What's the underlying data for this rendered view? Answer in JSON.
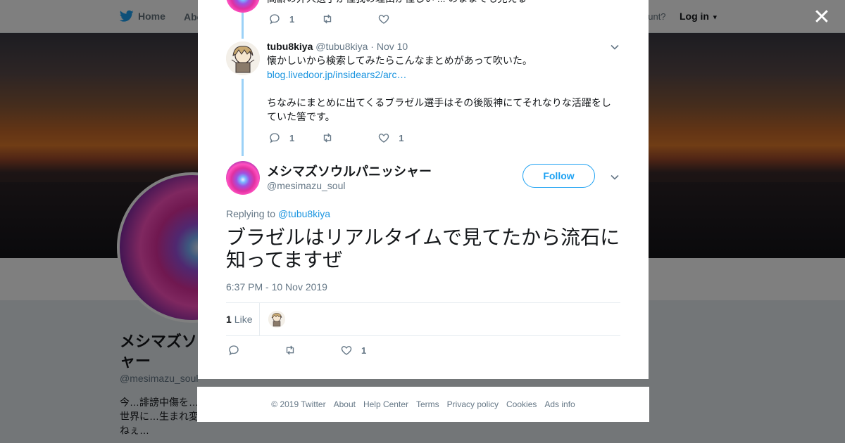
{
  "topbar": {
    "home_label": "Home",
    "about_label": "Abo",
    "account_text": "ccount?",
    "login_label": "Log in"
  },
  "profile": {
    "name": "メシマズソ\nャー",
    "handle": "@mesimazu_soul",
    "bio": "今…誹謗中傷を…\n世界に…生まれ変\nねぇ…"
  },
  "modal": {
    "top_tweet": {
      "text_partial": "高齢の外人選手が怪我の理由が怪しい ... のままでも見える",
      "reply_count": "1"
    },
    "tweet1": {
      "author_name": "tubu8kiya",
      "author_handle": "@tubu8kiya",
      "date": "Nov 10",
      "line1": "懐かしいから検索してみたらこんなまとめがあって吹いた。",
      "link": "blog.livedoor.jp/insidears2/arc…",
      "line2": "ちなみにまとめに出てくるブラゼル選手はその後阪神にてそれなりな活躍をしていた筈です。",
      "reply_count": "1",
      "like_count": "1"
    },
    "main_tweet": {
      "author_name": "メシマズソウルパニッシャー",
      "author_handle": "@mesimazu_soul",
      "follow_label": "Follow",
      "replying_prefix": "Replying to ",
      "replying_to": "@tubu8kiya",
      "text": "ブラゼルはリアルタイムで見てたから流石に知ってますぜ",
      "timestamp": "6:37 PM - 10 Nov 2019",
      "likes_number": "1",
      "likes_label": "Like",
      "like_count": "1"
    }
  },
  "footer": {
    "links": [
      "© 2019 Twitter",
      "About",
      "Help Center",
      "Terms",
      "Privacy policy",
      "Cookies",
      "Ads info"
    ]
  },
  "colors": {
    "accent": "#1da1f2",
    "link": "#1b95e0",
    "thread": "#9bd1f7",
    "muted": "#657786"
  }
}
